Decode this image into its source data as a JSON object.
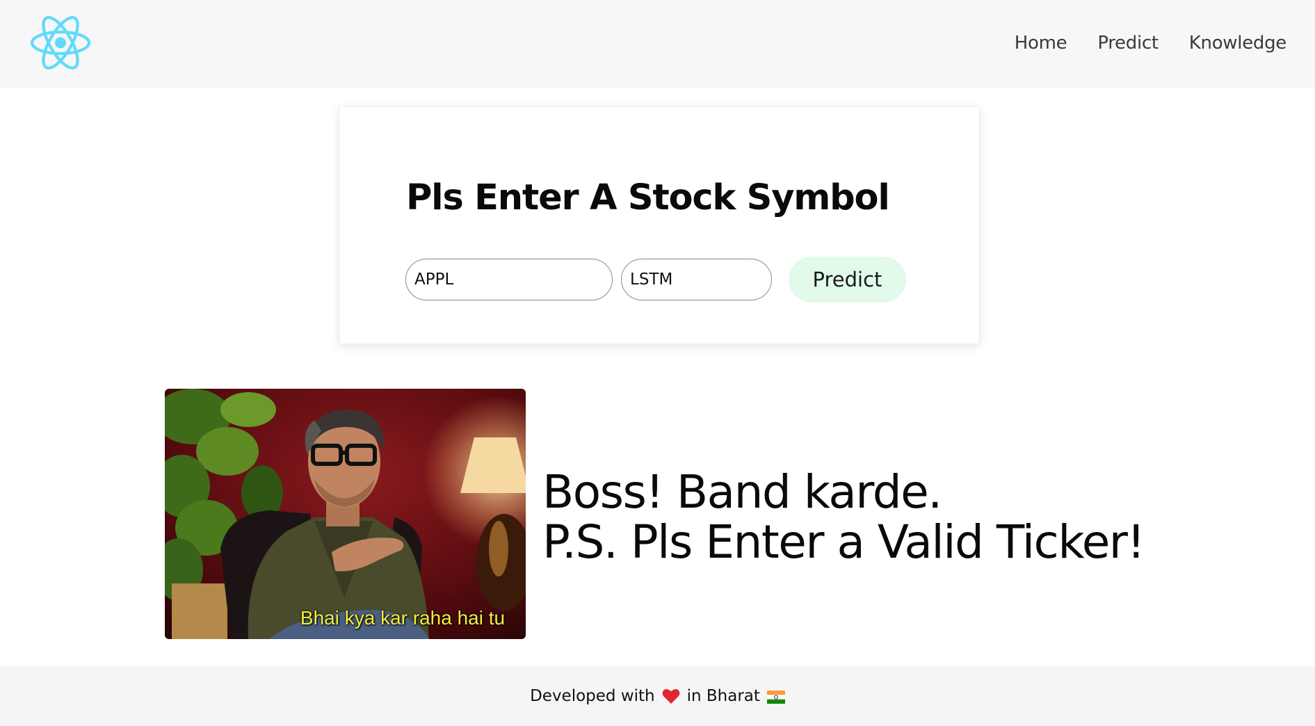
{
  "navbar": {
    "logo_icon": "react-atom-icon",
    "links": [
      {
        "label": "Home"
      },
      {
        "label": "Predict"
      },
      {
        "label": "Knowledge"
      }
    ]
  },
  "form": {
    "title": "Pls Enter A Stock Symbol",
    "symbol_value": "APPL",
    "model_value": "LSTM",
    "submit_label": "Predict"
  },
  "meme": {
    "caption": "Bhai kya kar raha hai tu"
  },
  "message": {
    "line1": "Boss! Band karde.",
    "line2": "P.S. Pls Enter a Valid Ticker!"
  },
  "footer": {
    "text_before": "Developed with",
    "heart_icon": "heart-icon",
    "text_after": "in Bharat",
    "flag_icon": "india-flag-icon"
  },
  "colors": {
    "navbar_bg": "#f7f7f7",
    "logo": "#61dafb",
    "button_bg": "#e1faea",
    "caption": "#f2ee3a",
    "heart": "#e0262f"
  }
}
